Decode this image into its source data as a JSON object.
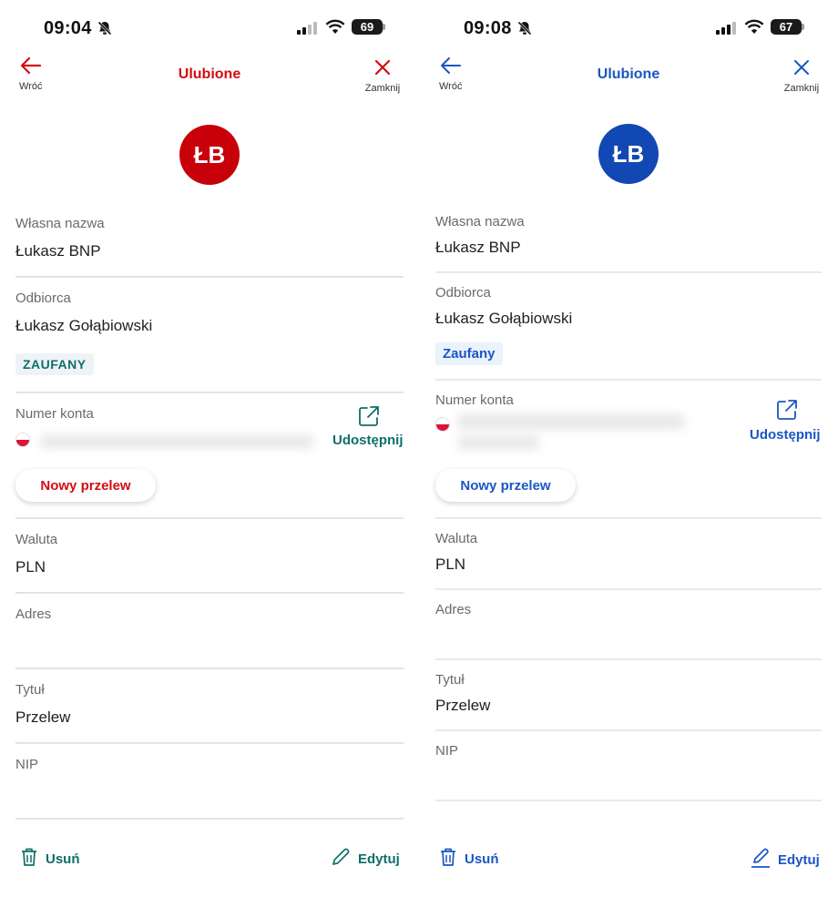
{
  "left": {
    "status": {
      "time": "09:04",
      "battery": "69"
    },
    "nav": {
      "back_label": "Wróć",
      "title": "Ulubione",
      "close_label": "Zamknij"
    },
    "avatar_initials": "ŁB",
    "fields": {
      "own_name_label": "Własna nazwa",
      "own_name_value": "Łukasz BNP",
      "recipient_label": "Odbiorca",
      "recipient_value": "Łukasz Gołąbiowski",
      "trusted_badge": "ZAUFANY",
      "account_label": "Numer konta",
      "share_label": "Udostępnij",
      "new_transfer_label": "Nowy przelew",
      "currency_label": "Waluta",
      "currency_value": "PLN",
      "address_label": "Adres",
      "title_label": "Tytuł",
      "title_value": "Przelew",
      "nip_label": "NIP"
    },
    "actions": {
      "delete_label": "Usuń",
      "edit_label": "Edytuj"
    },
    "colors": {
      "accent": "#d40b11",
      "avatar": "#c8000a",
      "secondary": "#0f6e6a",
      "badge_bg": "#eef3f6",
      "badge_text": "#0f6e6a"
    }
  },
  "right": {
    "status": {
      "time": "09:08",
      "battery": "67"
    },
    "nav": {
      "back_label": "Wróć",
      "title": "Ulubione",
      "close_label": "Zamknij"
    },
    "avatar_initials": "ŁB",
    "fields": {
      "own_name_label": "Własna nazwa",
      "own_name_value": "Łukasz BNP",
      "recipient_label": "Odbiorca",
      "recipient_value": "Łukasz Gołąbiowski",
      "trusted_badge": "Zaufany",
      "account_label": "Numer konta",
      "share_label": "Udostępnij",
      "new_transfer_label": "Nowy przelew",
      "currency_label": "Waluta",
      "currency_value": "PLN",
      "address_label": "Adres",
      "title_label": "Tytuł",
      "title_value": "Przelew",
      "nip_label": "NIP"
    },
    "actions": {
      "delete_label": "Usuń",
      "edit_label": "Edytuj"
    },
    "colors": {
      "accent": "#1a56c4",
      "avatar": "#1248b3",
      "secondary": "#1a56c4",
      "badge_bg": "#eaf2fb",
      "badge_text": "#1a56c4"
    }
  }
}
